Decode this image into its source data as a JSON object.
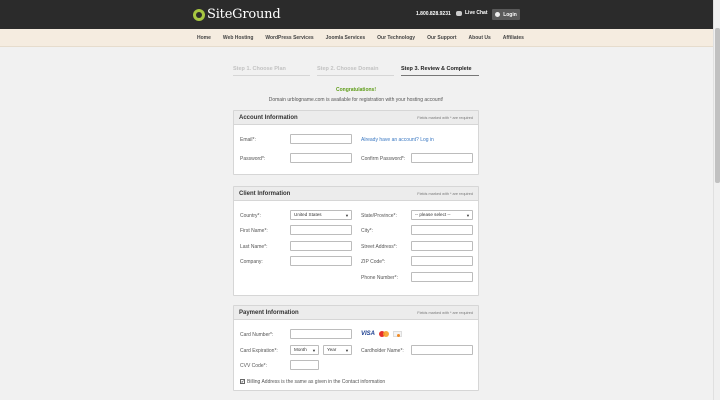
{
  "header": {
    "logo_text": "SiteGround",
    "phone": "1.800.828.9231",
    "live_chat": "Live Chat",
    "login": "Login"
  },
  "nav": {
    "items": [
      "Home",
      "Web Hosting",
      "WordPress Services",
      "Joomla Services",
      "Our Technology",
      "Our Support",
      "About Us",
      "Affiliates"
    ]
  },
  "steps": {
    "step1": "Step 1. Choose Plan",
    "step2": "Step 2. Choose Domain",
    "step3": "Step 3. Review & Complete"
  },
  "messages": {
    "congrats": "Congratulations!",
    "domain_available": "Domain urblogname.com is available for registration with your hosting account!"
  },
  "fields_note": "Fields marked with * are required",
  "account": {
    "title": "Account Information",
    "email": "Email*:",
    "have_account": "Already have an account? Log in",
    "password": "Password*:",
    "confirm_password": "Confirm Password*:"
  },
  "client": {
    "title": "Client Information",
    "country": "Country*:",
    "country_value": "United States",
    "state": "State/Province*:",
    "state_value": "-- please select --",
    "first_name": "First Name*:",
    "city": "City*:",
    "last_name": "Last Name*:",
    "street": "Street Address*:",
    "company": "Company:",
    "zip": "ZIP Code*:",
    "phone": "Phone Number*:"
  },
  "payment": {
    "title": "Payment Information",
    "card_number": "Card Number*:",
    "card_brands": [
      "VISA"
    ],
    "card_expiration": "Card Expiration*:",
    "month": "Month",
    "year": "Year",
    "cardholder": "Cardholder Name*:",
    "cvv": "CVV Code*:",
    "billing_same": "Billing Address is the same as given in the Contact information",
    "billing_checked": true
  },
  "colors": {
    "topbar": "#2b2b2b",
    "logo_accent": "#a7c641",
    "nav_bg": "#f5ece0",
    "link": "#3a78c2",
    "congrats": "#5e9c18"
  }
}
